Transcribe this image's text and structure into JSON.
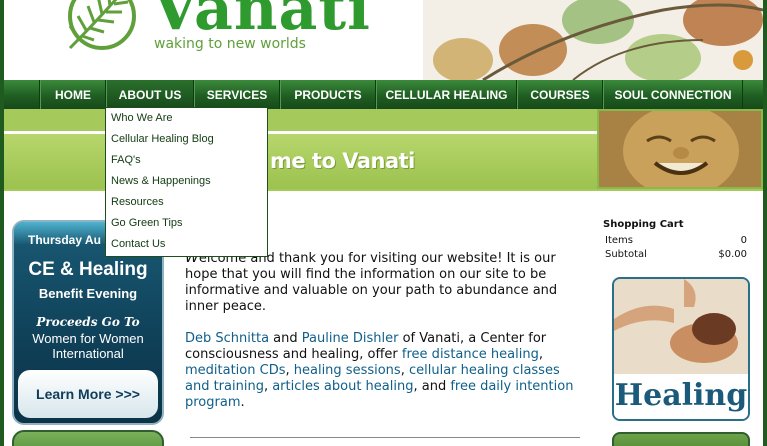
{
  "header": {
    "logo_text": "Vanati",
    "tagline": "waking to new worlds"
  },
  "nav": {
    "items": [
      {
        "label": "HOME"
      },
      {
        "label": "ABOUT US"
      },
      {
        "label": "SERVICES"
      },
      {
        "label": "PRODUCTS"
      },
      {
        "label": "CELLULAR HEALING"
      },
      {
        "label": "COURSES"
      },
      {
        "label": "SOUL CONNECTION"
      }
    ],
    "active": "ABOUT US"
  },
  "dropdown": {
    "items": [
      {
        "label": "Who We Are"
      },
      {
        "label": "Cellular Healing Blog"
      },
      {
        "label": "FAQ's"
      },
      {
        "label": "News & Happenings"
      },
      {
        "label": "Resources"
      },
      {
        "label": "Go Green Tips"
      },
      {
        "label": "Contact Us"
      }
    ]
  },
  "banner": {
    "title_visible": "me to Vanati"
  },
  "promo": {
    "date": "Thursday Au",
    "headline": "CE & Healing",
    "subheadline": "Benefit Evening",
    "proceeds": "Proceeds Go To",
    "org_line1": "Women for Women",
    "org_line2": "International",
    "button": "Learn More >>>"
  },
  "main": {
    "dropcap": "W",
    "p1": "elcome and thank you for visiting our website! It is our hope that you will find the information on our site to be informative and valuable on your path to abundance and inner peace.",
    "p2": {
      "name1": "Deb Schnitta",
      "and1": " and ",
      "name2": "Pauline Dishler",
      "text1": " of Vanati, a Center for consciousness and healing, offer ",
      "link1": "free distance healing",
      "comma1": ", ",
      "link2": "meditation CDs",
      "comma2": ", ",
      "link3": "healing sessions",
      "comma3": ", ",
      "link4": "cellular healing classes and training",
      "comma4": ", ",
      "link5": "articles about healing",
      "and2": ", and ",
      "link6": "free daily intention program",
      "end": "."
    }
  },
  "cart": {
    "title": "Shopping Cart",
    "items_label": "Items",
    "items_value": "0",
    "subtotal_label": "Subtotal",
    "subtotal_value": "$0.00"
  },
  "side": {
    "healing_label": "Healing"
  }
}
